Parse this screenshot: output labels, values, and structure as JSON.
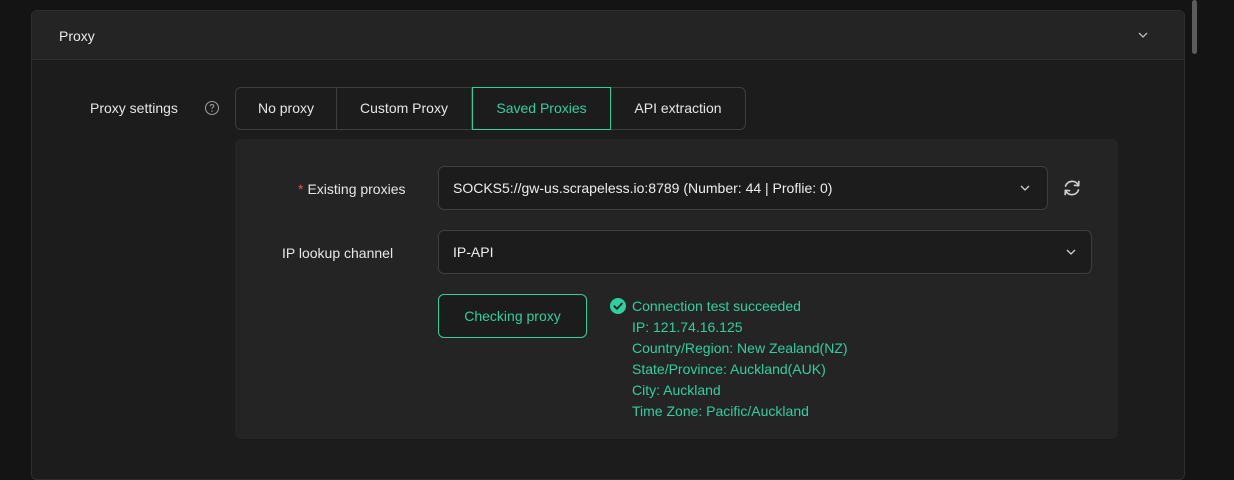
{
  "panel": {
    "title": "Proxy",
    "collapse_icon": "chevron-down-icon"
  },
  "proxy_settings": {
    "label": "Proxy settings",
    "help_icon": "question-circle-icon",
    "options": [
      {
        "label": "No proxy",
        "active": false
      },
      {
        "label": "Custom Proxy",
        "active": false
      },
      {
        "label": "Saved Proxies",
        "active": true
      },
      {
        "label": "API extraction",
        "active": false
      }
    ]
  },
  "existing_proxies": {
    "required_mark": "*",
    "label": "Existing proxies",
    "value": "SOCKS5://gw-us.scrapeless.io:8789 (Number: 44 | Proflie: 0)",
    "refresh_icon": "refresh-icon"
  },
  "ip_lookup": {
    "label": "IP lookup channel",
    "value": "IP-API"
  },
  "check": {
    "button_label": "Checking proxy",
    "status_icon": "check-circle-icon",
    "lines": [
      "Connection test succeeded",
      "IP: 121.74.16.125",
      "Country/Region: New Zealand(NZ)",
      "State/Province: Auckland(AUK)",
      "City: Auckland",
      "Time Zone: Pacific/Auckland"
    ]
  },
  "colors": {
    "accent": "#2fd0a0",
    "required": "#e05252",
    "background": "#141414",
    "panel": "#1c1c1c",
    "sub_panel": "#242424"
  }
}
